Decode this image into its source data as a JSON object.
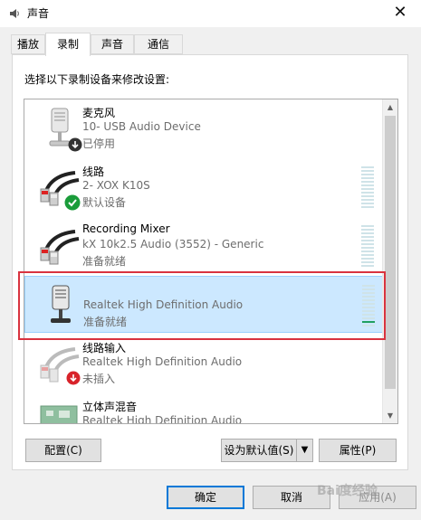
{
  "window": {
    "title": "声音",
    "close": "✕"
  },
  "tabs": [
    {
      "label": "播放"
    },
    {
      "label": "录制"
    },
    {
      "label": "声音"
    },
    {
      "label": "通信"
    }
  ],
  "panel": {
    "instruction": "选择以下录制设备来修改设置:"
  },
  "devices": [
    {
      "name": "麦克风",
      "desc": "10- USB Audio Device",
      "status": "已停用"
    },
    {
      "name": "线路",
      "desc": "2- XOX K10S",
      "status": "默认设备"
    },
    {
      "name": "Recording Mixer",
      "desc": "kX 10k2.5 Audio (3552) - Generic",
      "status": "准备就绪"
    },
    {
      "name": "",
      "desc": "Realtek High Definition Audio",
      "status": "准备就绪"
    },
    {
      "name": "线路输入",
      "desc": "Realtek High Definition Audio",
      "status": "未插入"
    },
    {
      "name": "立体声混音",
      "desc": "Realtek High Definition Audio",
      "status": ""
    }
  ],
  "buttons": {
    "configure": "配置(C)",
    "set_default": "设为默认值(S)",
    "properties": "属性(P)",
    "ok": "确定",
    "cancel": "取消",
    "apply": "应用(A)"
  },
  "watermark": "Bai度经验",
  "colors": {
    "selection": "#cce8ff",
    "highlight_border": "#d9333f",
    "default_check": "#1a9c3a",
    "disabled_arrow": "#333333",
    "unplugged_arrow": "#d8232a"
  }
}
